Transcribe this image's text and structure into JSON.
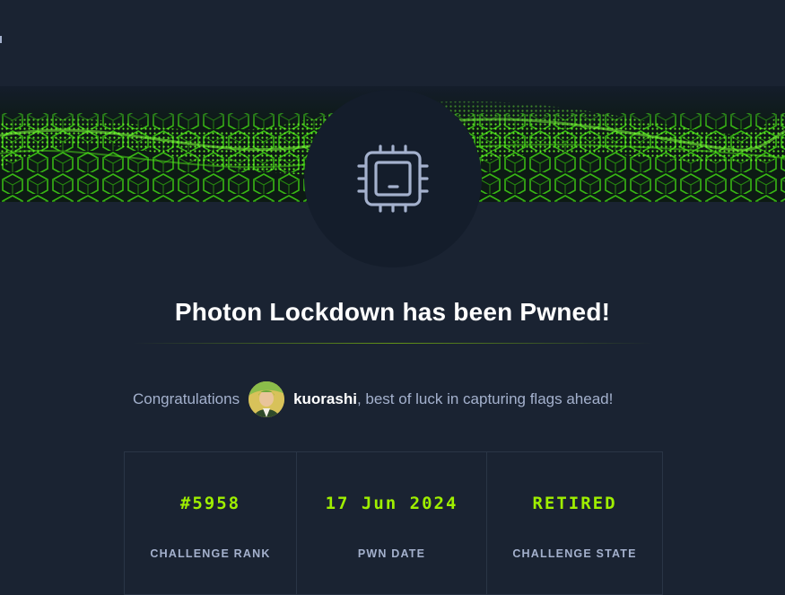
{
  "challenge": {
    "name": "Photon Lockdown",
    "title": "Photon Lockdown has been Pwned!",
    "icon": "cpu-chip-icon"
  },
  "congrats": {
    "prefix": "Congratulations",
    "username": "kuorashi",
    "suffix": ", best of luck in capturing flags ahead!"
  },
  "stats": [
    {
      "value": "#5958",
      "label": "CHALLENGE RANK"
    },
    {
      "value": "17 Jun 2024",
      "label": "PWN DATE"
    },
    {
      "value": "RETIRED",
      "label": "CHALLENGE STATE"
    }
  ],
  "colors": {
    "background": "#1a2332",
    "accent": "#9fef00",
    "muted_text": "#a4b1cd",
    "badge_bg": "#141d2b"
  }
}
